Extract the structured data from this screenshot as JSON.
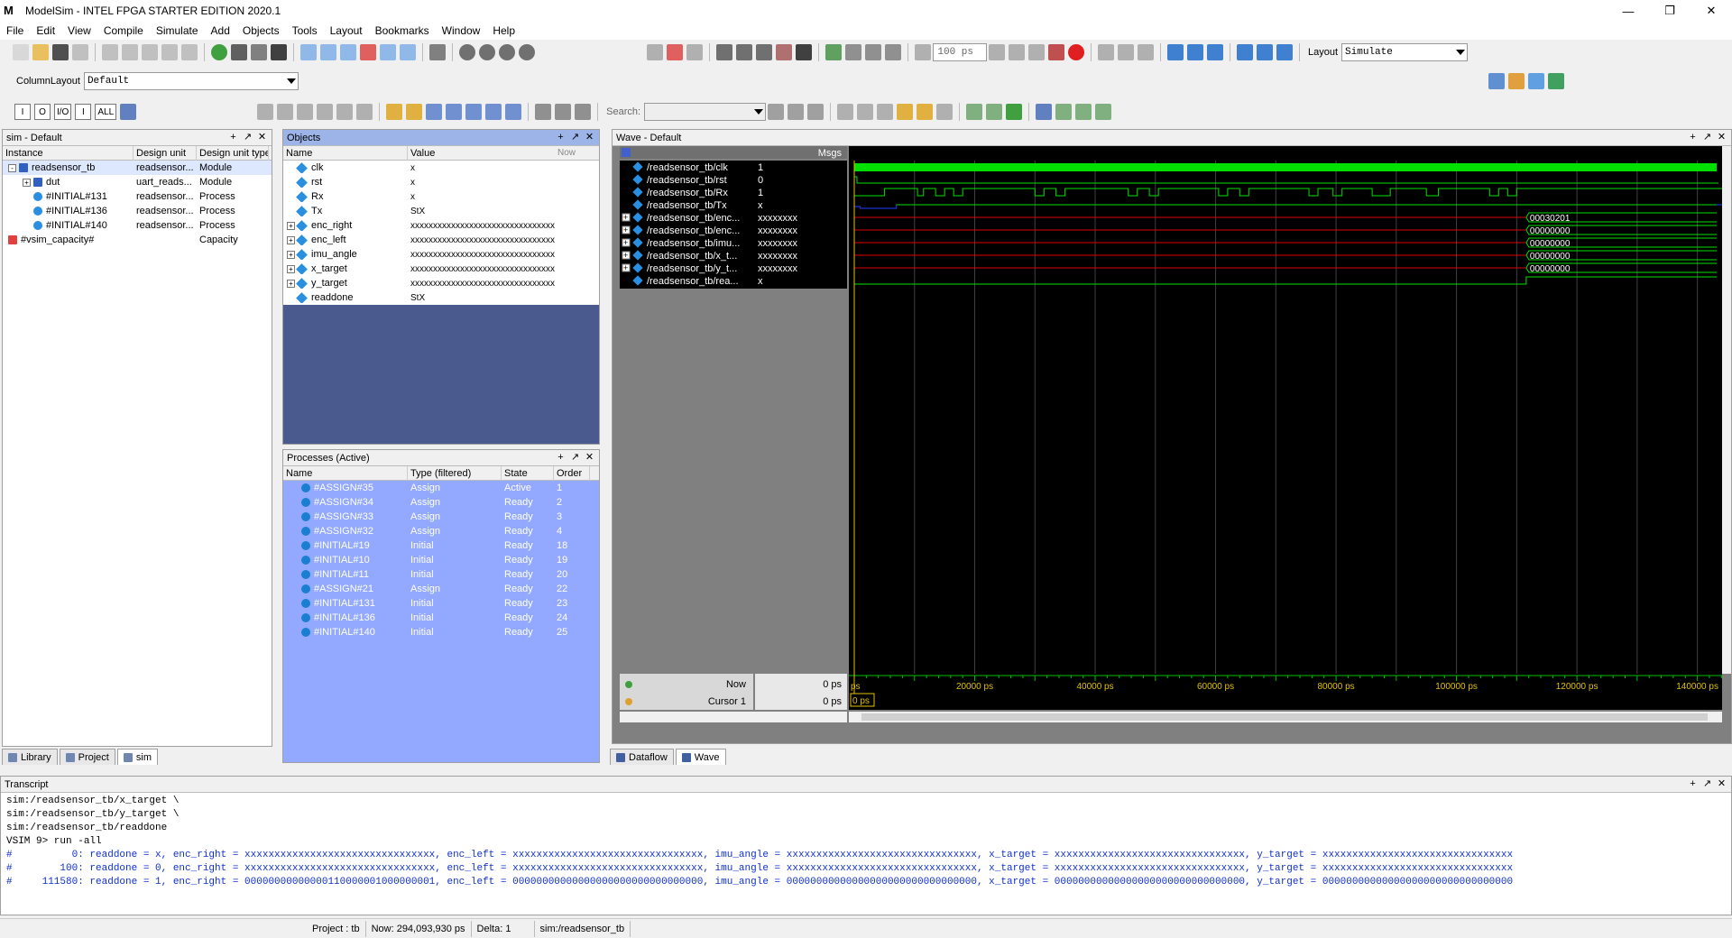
{
  "window": {
    "title": "ModelSim - INTEL FPGA STARTER EDITION 2020.1",
    "logo": "M"
  },
  "menu": [
    "File",
    "Edit",
    "View",
    "Compile",
    "Simulate",
    "Add",
    "Objects",
    "Tools",
    "Layout",
    "Bookmarks",
    "Window",
    "Help"
  ],
  "toolbar": {
    "zoom_value": "100 ps",
    "layout_label": "Layout",
    "layout_value": "Simulate",
    "column_layout_label": "ColumnLayout",
    "column_layout_value": "Default",
    "search_label": "Search:"
  },
  "mode_buttons": [
    "I",
    "O",
    "I/O",
    "I",
    "ALL"
  ],
  "sim_panel": {
    "title": "sim - Default",
    "columns": [
      "Instance",
      "Design unit",
      "Design unit type"
    ],
    "rows": [
      {
        "instance": "readsensor_tb",
        "unit": "readsensor...",
        "type": "Module",
        "pm": "-",
        "indent": 0
      },
      {
        "instance": "dut",
        "unit": "uart_reads...",
        "type": "Module",
        "pm": "+",
        "indent": 1
      },
      {
        "instance": "#INITIAL#131",
        "unit": "readsensor...",
        "type": "Process",
        "pm": "",
        "indent": 1
      },
      {
        "instance": "#INITIAL#136",
        "unit": "readsensor...",
        "type": "Process",
        "pm": "",
        "indent": 1
      },
      {
        "instance": "#INITIAL#140",
        "unit": "readsensor...",
        "type": "Process",
        "pm": "",
        "indent": 1
      },
      {
        "instance": "#vsim_capacity#",
        "unit": "",
        "type": "Capacity",
        "pm": "",
        "indent": 0
      }
    ],
    "tabs": [
      "Library",
      "Project",
      "sim"
    ]
  },
  "objects_panel": {
    "title": "Objects",
    "columns": [
      "Name",
      "Value"
    ],
    "now_label": "Now",
    "rows": [
      {
        "name": "clk",
        "value": "x",
        "pm": ""
      },
      {
        "name": "rst",
        "value": "x",
        "pm": ""
      },
      {
        "name": "Rx",
        "value": "x",
        "pm": ""
      },
      {
        "name": "Tx",
        "value": "StX",
        "pm": ""
      },
      {
        "name": "enc_right",
        "value": "xxxxxxxxxxxxxxxxxxxxxxxxxxxxxxxx",
        "pm": "+"
      },
      {
        "name": "enc_left",
        "value": "xxxxxxxxxxxxxxxxxxxxxxxxxxxxxxxx",
        "pm": "+"
      },
      {
        "name": "imu_angle",
        "value": "xxxxxxxxxxxxxxxxxxxxxxxxxxxxxxxx",
        "pm": "+"
      },
      {
        "name": "x_target",
        "value": "xxxxxxxxxxxxxxxxxxxxxxxxxxxxxxxx",
        "pm": "+"
      },
      {
        "name": "y_target",
        "value": "xxxxxxxxxxxxxxxxxxxxxxxxxxxxxxxx",
        "pm": "+"
      },
      {
        "name": "readdone",
        "value": "StX",
        "pm": ""
      }
    ]
  },
  "processes_panel": {
    "title": "Processes (Active)",
    "columns": [
      "Name",
      "Type (filtered)",
      "State",
      "Order"
    ],
    "rows": [
      {
        "name": "#ASSIGN#35",
        "type": "Assign",
        "state": "Active",
        "order": "1"
      },
      {
        "name": "#ASSIGN#34",
        "type": "Assign",
        "state": "Ready",
        "order": "2"
      },
      {
        "name": "#ASSIGN#33",
        "type": "Assign",
        "state": "Ready",
        "order": "3"
      },
      {
        "name": "#ASSIGN#32",
        "type": "Assign",
        "state": "Ready",
        "order": "4"
      },
      {
        "name": "#INITIAL#19",
        "type": "Initial",
        "state": "Ready",
        "order": "18"
      },
      {
        "name": "#INITIAL#10",
        "type": "Initial",
        "state": "Ready",
        "order": "19"
      },
      {
        "name": "#INITIAL#11",
        "type": "Initial",
        "state": "Ready",
        "order": "20"
      },
      {
        "name": "#ASSIGN#21",
        "type": "Assign",
        "state": "Ready",
        "order": "22"
      },
      {
        "name": "#INITIAL#131",
        "type": "Initial",
        "state": "Ready",
        "order": "23"
      },
      {
        "name": "#INITIAL#136",
        "type": "Initial",
        "state": "Ready",
        "order": "24"
      },
      {
        "name": "#INITIAL#140",
        "type": "Initial",
        "state": "Ready",
        "order": "25"
      }
    ]
  },
  "wave_panel": {
    "title": "Wave - Default",
    "msgs_label": "Msgs",
    "signals": [
      {
        "name": "/readsensor_tb/clk",
        "value": "1",
        "pm": ""
      },
      {
        "name": "/readsensor_tb/rst",
        "value": "0",
        "pm": ""
      },
      {
        "name": "/readsensor_tb/Rx",
        "value": "1",
        "pm": ""
      },
      {
        "name": "/readsensor_tb/Tx",
        "value": "x",
        "pm": ""
      },
      {
        "name": "/readsensor_tb/enc...",
        "value": "xxxxxxxx",
        "pm": "+"
      },
      {
        "name": "/readsensor_tb/enc...",
        "value": "xxxxxxxx",
        "pm": "+"
      },
      {
        "name": "/readsensor_tb/imu...",
        "value": "xxxxxxxx",
        "pm": "+"
      },
      {
        "name": "/readsensor_tb/x_t...",
        "value": "xxxxxxxx",
        "pm": "+"
      },
      {
        "name": "/readsensor_tb/y_t...",
        "value": "xxxxxxxx",
        "pm": "+"
      },
      {
        "name": "/readsensor_tb/rea...",
        "value": "x",
        "pm": ""
      }
    ],
    "bus_end_values": [
      "00030201",
      "00000000",
      "00000000",
      "00000000",
      "00000000"
    ],
    "now_label": "Now",
    "now_value": "0 ps",
    "cursor_label": "Cursor 1",
    "cursor_value": "0 ps",
    "cursor_marker": "0 ps",
    "time_start_label": "ps",
    "time_ticks": [
      "20000 ps",
      "40000 ps",
      "60000 ps",
      "80000 ps",
      "100000 ps",
      "120000 ps",
      "140000 ps"
    ],
    "colors": {
      "bg": "#000000",
      "signal": "#00e000",
      "bus_x": "#e00000",
      "tx": "#2040ff",
      "grid": "#404040"
    },
    "tabs": [
      "Dataflow",
      "Wave"
    ]
  },
  "transcript": {
    "title": "Transcript",
    "lines": [
      {
        "text": "sim:/readsensor_tb/x_target \\",
        "color": "#000"
      },
      {
        "text": "sim:/readsensor_tb/y_target \\",
        "color": "#000"
      },
      {
        "text": "sim:/readsensor_tb/readdone",
        "color": "#000"
      },
      {
        "text": "VSIM 9> run -all",
        "color": "#000"
      },
      {
        "text": "#          0: readdone = x, enc_right = xxxxxxxxxxxxxxxxxxxxxxxxxxxxxxxx, enc_left = xxxxxxxxxxxxxxxxxxxxxxxxxxxxxxxx, imu_angle = xxxxxxxxxxxxxxxxxxxxxxxxxxxxxxxx, x_target = xxxxxxxxxxxxxxxxxxxxxxxxxxxxxxxx, y_target = xxxxxxxxxxxxxxxxxxxxxxxxxxxxxxxx",
        "color": "#1030d0"
      },
      {
        "text": "#        100: readdone = 0, enc_right = xxxxxxxxxxxxxxxxxxxxxxxxxxxxxxxx, enc_left = xxxxxxxxxxxxxxxxxxxxxxxxxxxxxxxx, imu_angle = xxxxxxxxxxxxxxxxxxxxxxxxxxxxxxxx, x_target = xxxxxxxxxxxxxxxxxxxxxxxxxxxxxxxx, y_target = xxxxxxxxxxxxxxxxxxxxxxxxxxxxxxxx",
        "color": "#1030d0"
      },
      {
        "text": "#     111580: readdone = 1, enc_right = 00000000000000110000001000000001, enc_left = 00000000000000000000000000000000, imu_angle = 00000000000000000000000000000000, x_target = 00000000000000000000000000000000, y_target = 00000000000000000000000000000000",
        "color": "#1030d0"
      }
    ]
  },
  "status": {
    "project": "Project : tb",
    "now": "Now: 294,093,930 ps",
    "delta": "Delta: 1",
    "path": "sim:/readsensor_tb"
  }
}
